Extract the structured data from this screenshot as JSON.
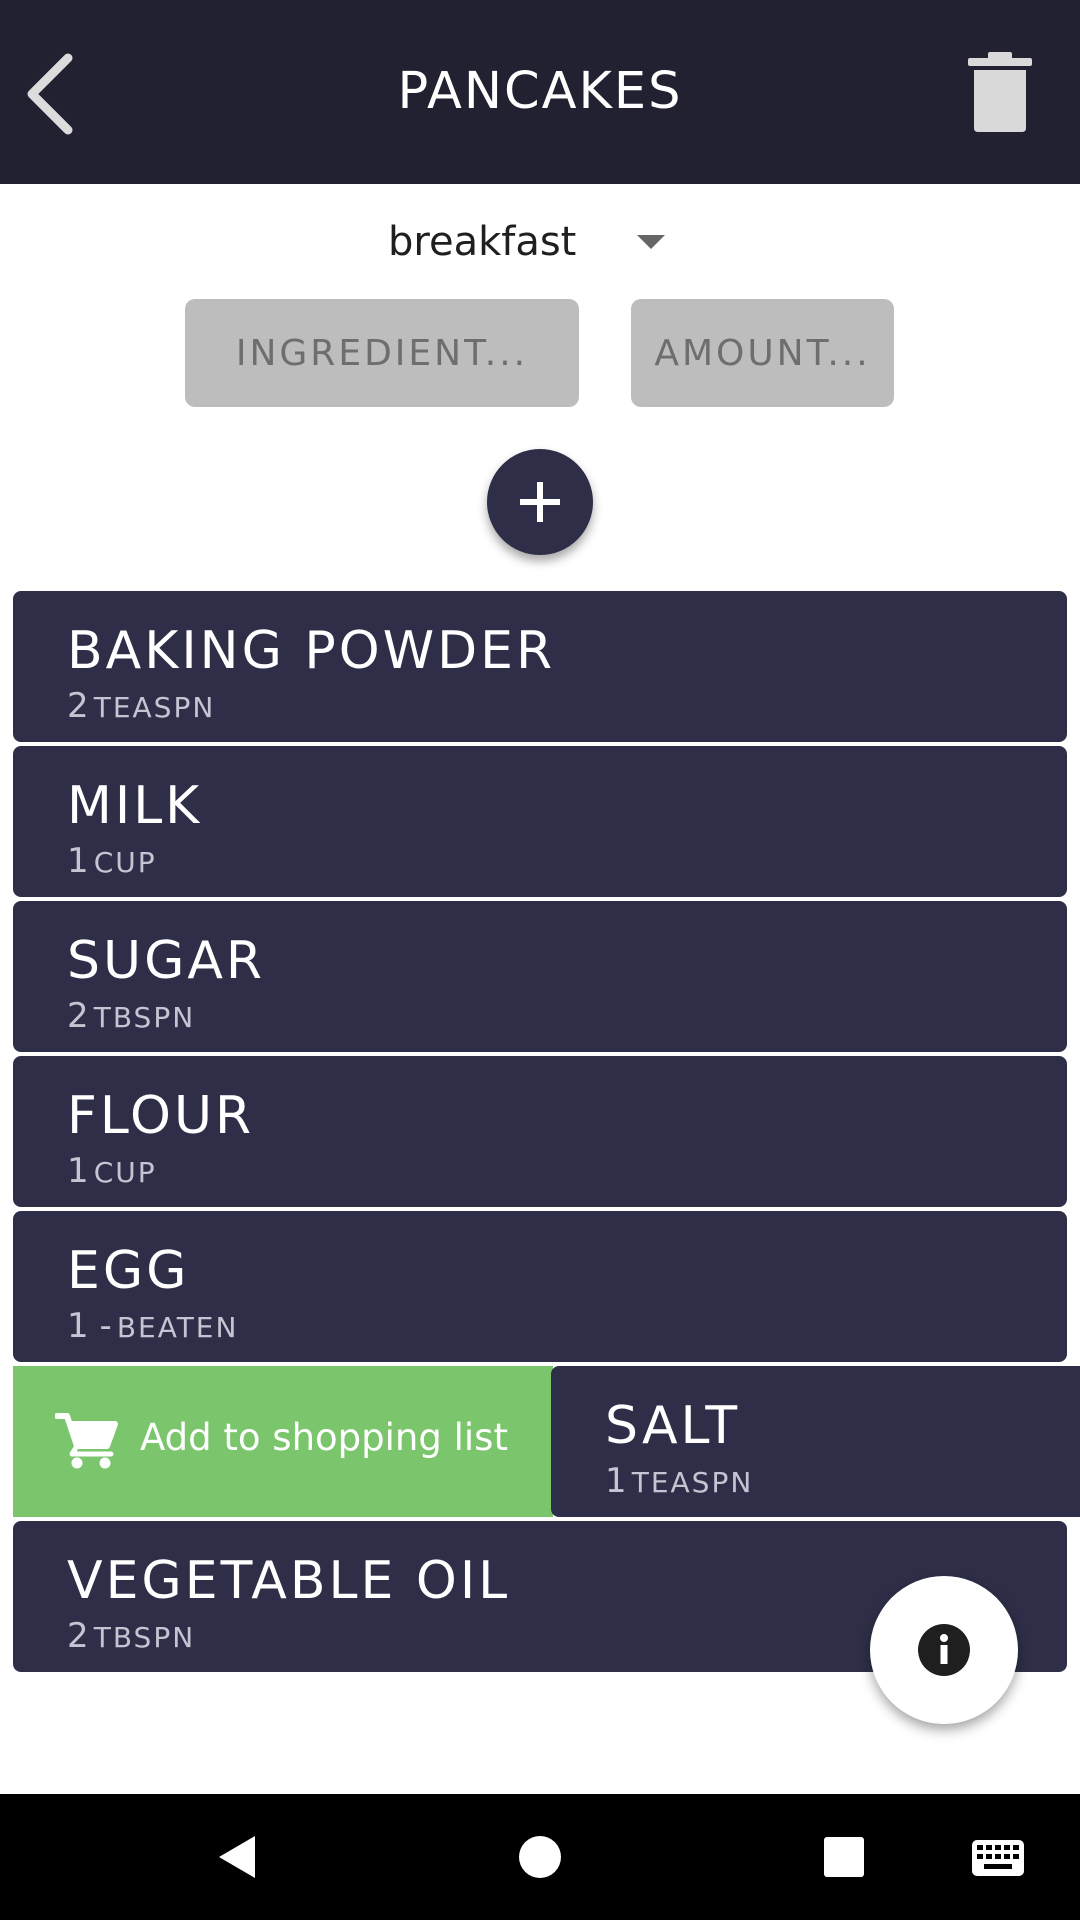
{
  "header": {
    "title": "PANCAKES",
    "back_icon": "chevron-left-icon",
    "delete_icon": "trash-icon"
  },
  "category": {
    "value": "breakfast"
  },
  "form": {
    "ingredient_button": "INGREDIENT...",
    "amount_button": "AMOUNT..."
  },
  "ingredients": [
    {
      "name": "BAKING POWDER",
      "qty": "2",
      "unit": "TEASPN"
    },
    {
      "name": "MILK",
      "qty": "1",
      "unit": "CUP"
    },
    {
      "name": "SUGAR",
      "qty": "2",
      "unit": "TBSPN"
    },
    {
      "name": "FLOUR",
      "qty": "1",
      "unit": "CUP"
    },
    {
      "name": "EGG",
      "qty": "1 -",
      "unit": "BEATEN"
    },
    {
      "name": "SALT",
      "qty": "1",
      "unit": "TEASPN"
    },
    {
      "name": "VEGETABLE OIL",
      "qty": "2",
      "unit": "TBSPN"
    }
  ],
  "swipe_action": {
    "label": "Add to shopping list",
    "icon": "shopping-cart-icon"
  },
  "colors": {
    "appbar": "#212131",
    "row": "#2e2e48",
    "swipe_action": "#7bc66d",
    "field_button": "#bdbdbd"
  }
}
